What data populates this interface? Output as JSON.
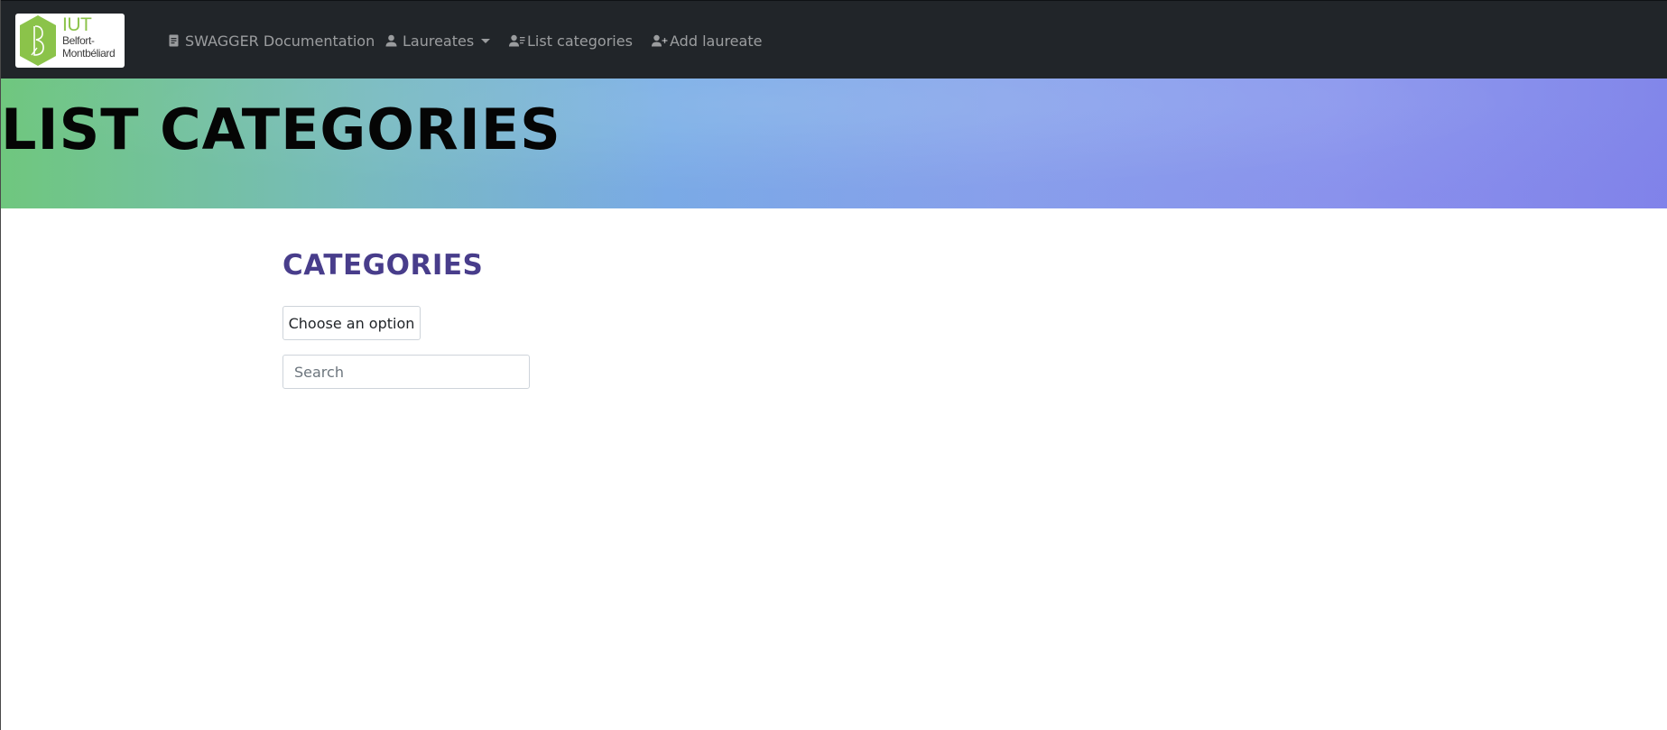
{
  "brand": {
    "logo_title": "IUT",
    "logo_line1": "Belfort-",
    "logo_line2": "Montbéliard",
    "logo_color": "#8bc34a"
  },
  "navbar": {
    "items": [
      {
        "label": "SWAGGER Documentation",
        "icon": "document-icon"
      },
      {
        "label": "Laureates",
        "icon": "user-icon",
        "dropdown": true
      },
      {
        "label": "List categories",
        "icon": "user-list-icon"
      },
      {
        "label": "Add laureate",
        "icon": "user-plus-icon"
      }
    ],
    "background": "#212529"
  },
  "hero": {
    "title": "LIST CATEGORIES"
  },
  "main": {
    "section_title": "CATEGORIES",
    "section_title_color": "#483d8b",
    "option_button_label": "Choose an option",
    "search_placeholder": "Search",
    "search_value": ""
  }
}
